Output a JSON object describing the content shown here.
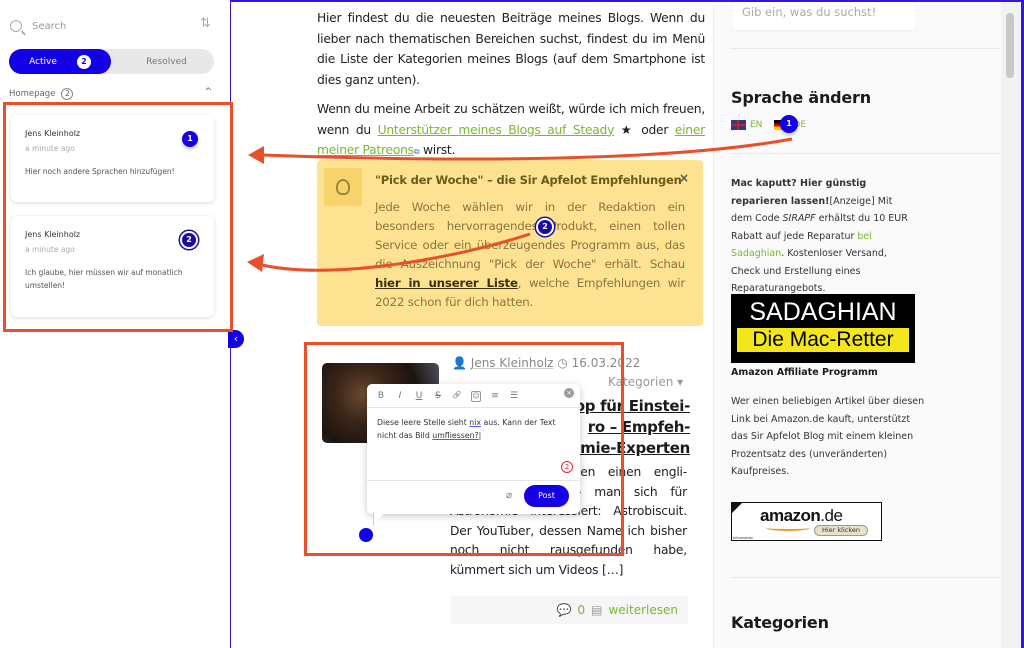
{
  "comments_panel": {
    "search_placeholder": "Search",
    "tabs": [
      {
        "label": "Active",
        "count": "2"
      },
      {
        "label": "Resolved"
      }
    ],
    "group": {
      "label": "Homepage",
      "count": "2"
    },
    "comments": [
      {
        "pin": "1",
        "author": "Jens Kleinholz",
        "time": "a minute ago",
        "text": "Hier noch andere Sprachen hinzufügen!"
      },
      {
        "pin": "2",
        "author": "Jens Kleinholz",
        "time": "a minute ago",
        "text": "Ich glaube, hier müssen wir auf monatlich umstellen!"
      }
    ],
    "collapse_icon": "‹"
  },
  "blog": {
    "intro_p1": "Hier findest du die neuesten Beiträge meines Blogs. Wenn du lieber nach thematischen Bereichen suchst, findest du im Menü die Liste der Kategorien meines Blogs (auf dem Smartphone ist dies ganz unten).",
    "intro_p2_a": "Wenn du meine Arbeit zu schätzen weißt, würde ich mich freuen, wenn du ",
    "intro_p2_link1": "Unterstützer meines Blogs auf Steady",
    "intro_p2_b": " oder ",
    "intro_p2_link2": "einer meiner Patreons",
    "intro_p2_c": " wirst.",
    "tip": {
      "title": "\"Pick der Woche\" – die Sir Apfelot Empfehlungen",
      "text_a": "Jede Woche wählen wir in der Redaktion ein besonders hervorragendes Produkt, einen tollen Service oder ein überzeugendes Programm aus, das die Auszeichnung \"Pick der Woche\" erhält. Schau ",
      "link": "hier in unserer Liste",
      "text_b": ", welche Empfehlungen wir 2022 schon für dich hatten.",
      "close": "×"
    },
    "post": {
      "author": "Jens Kleinholz",
      "date": "16.03.2022",
      "categories": "Kategorien ▾",
      "title": "…op für Einstei-…ro – Empfeh-…omie-Experten",
      "title_lines": [
        "op für Einstei-",
        "ro – Empfeh-",
        "omie-Experten"
      ],
      "excerpt": "Tagen einen engli- entdeckt, der wirk- man sich für Astronomie interessiert: Astrobiscuit. Der YouTuber, dessen Name ich bisher noch nicht rausgefunden habe, kümmert sich um Videos […]",
      "comments_count": "0",
      "read_more": "weiterlesen"
    }
  },
  "sidebar": {
    "search_placeholder": "Gib ein, was du suchst!",
    "lang_heading": "Sprache ändern",
    "langs": [
      "EN",
      "DE"
    ],
    "lang_pin": "1",
    "ad_bold": "Mac kaputt? Hier günstig reparieren lassen!",
    "ad_a": "[Anzeige] Mit dem Code ",
    "ad_code": "SIRAPF",
    "ad_b": " erhältst du 10 EUR Rabatt auf jede Reparatur ",
    "ad_link": "bei Sadaghian",
    "ad_c": ". Kostenloser Versand, Check und Erstellung eines Reparaturangebots.",
    "sadaghian_line1": "SADAGHIAN",
    "sadaghian_line2": "Die Mac-Retter",
    "amazon_heading": "Amazon Affiliate Programm",
    "amazon_text": "Wer einen beliebigen Artikel über diesen Link bei Amazon.de kauft, unterstützt das Sir Apfelot Blog mit einem kleinen Prozentsatz des (unveränderten) Kaufpreises.",
    "amazon_logo": "amazon",
    "amazon_tld": ".de",
    "amazon_button": "Hier klicken",
    "amazon_info": "Information",
    "categories_heading": "Kategorien"
  },
  "comment_popup": {
    "toolbar": [
      "B",
      "I",
      "U",
      "S",
      "🔗",
      "☺",
      "≡",
      "☰"
    ],
    "text_a": "Diese leere Stelle sieht ",
    "text_nix": "nix",
    "text_b": " aus. Kann der Text nicht das Bild ",
    "text_err": "umfliessen?",
    "pin": "2",
    "post_label": "Post"
  },
  "pin_on_tip": "2",
  "colors": {
    "accent": "#1400e6",
    "annotation": "#e8502b",
    "link": "#7cb82f",
    "tip_bg": "#fde391"
  }
}
